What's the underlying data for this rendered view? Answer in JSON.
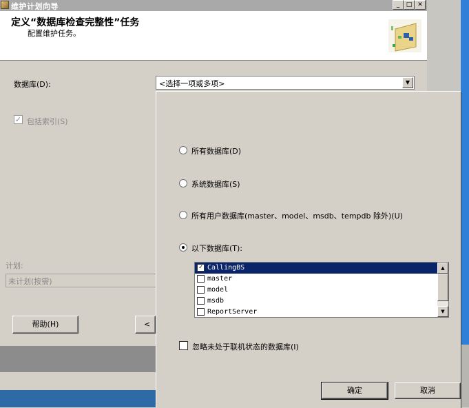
{
  "window": {
    "title": "维护计划向导",
    "min_glyph": "_",
    "max_glyph": "□",
    "close_glyph": "✕"
  },
  "header": {
    "title": "定义“数据库检查完整性”任务",
    "subtitle": "配置维护任务。"
  },
  "form": {
    "database_label": "数据库(D):",
    "database_value": "<选择一项或多项>",
    "include_indexes_label": "包括索引(S)",
    "include_indexes_checked": true,
    "schedule_label": "计划:",
    "schedule_value": "未计划(按需)"
  },
  "buttons": {
    "help": "帮助(H)",
    "back": "< 上"
  },
  "popup": {
    "options": [
      {
        "label": "所有数据库(D)",
        "selected": false
      },
      {
        "label": "系统数据库(S)",
        "selected": false
      },
      {
        "label": "所有用户数据库(master、model、msdb、tempdb 除外)(U)",
        "selected": false
      },
      {
        "label": "以下数据库(T):",
        "selected": true
      }
    ],
    "databases": [
      {
        "name": "CallingBS",
        "checked": true,
        "selected": true
      },
      {
        "name": "master",
        "checked": false,
        "selected": false
      },
      {
        "name": "model",
        "checked": false,
        "selected": false
      },
      {
        "name": "msdb",
        "checked": false,
        "selected": false
      },
      {
        "name": "ReportServer",
        "checked": false,
        "selected": false
      }
    ],
    "ignore_offline_label": "忽略未处于联机状态的数据库(I)",
    "ignore_offline_checked": false,
    "ok": "确定",
    "cancel": "取消"
  },
  "glyphs": {
    "check": "✓",
    "dropdown": "▼",
    "scroll_up": "▲",
    "scroll_down": "▼"
  }
}
